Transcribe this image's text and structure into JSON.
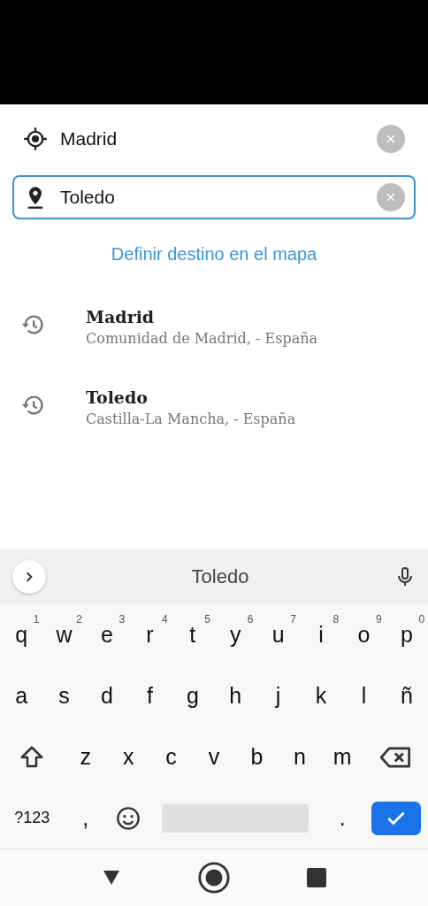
{
  "fields": [
    {
      "kind": "origin",
      "value": "Madrid",
      "focused": false
    },
    {
      "kind": "destination",
      "value": "Toledo",
      "focused": true
    }
  ],
  "map_link": "Definir destino en el mapa",
  "history": [
    {
      "title": "Madrid",
      "subtitle": "Comunidad de Madrid, - España"
    },
    {
      "title": "Toledo",
      "subtitle": "Castilla-La Mancha, - España"
    }
  ],
  "keyboard": {
    "suggestion": "Toledo",
    "rows": [
      [
        {
          "kind": "letter",
          "label": "q",
          "hint": "1"
        },
        {
          "kind": "letter",
          "label": "w",
          "hint": "2"
        },
        {
          "kind": "letter",
          "label": "e",
          "hint": "3"
        },
        {
          "kind": "letter",
          "label": "r",
          "hint": "4"
        },
        {
          "kind": "letter",
          "label": "t",
          "hint": "5"
        },
        {
          "kind": "letter",
          "label": "y",
          "hint": "6"
        },
        {
          "kind": "letter",
          "label": "u",
          "hint": "7"
        },
        {
          "kind": "letter",
          "label": "i",
          "hint": "8"
        },
        {
          "kind": "letter",
          "label": "o",
          "hint": "9"
        },
        {
          "kind": "letter",
          "label": "p",
          "hint": "0"
        }
      ],
      [
        {
          "kind": "letter",
          "label": "a"
        },
        {
          "kind": "letter",
          "label": "s"
        },
        {
          "kind": "letter",
          "label": "d"
        },
        {
          "kind": "letter",
          "label": "f"
        },
        {
          "kind": "letter",
          "label": "g"
        },
        {
          "kind": "letter",
          "label": "h"
        },
        {
          "kind": "letter",
          "label": "j"
        },
        {
          "kind": "letter",
          "label": "k"
        },
        {
          "kind": "letter",
          "label": "l"
        },
        {
          "kind": "letter",
          "label": "ñ"
        }
      ],
      [
        {
          "kind": "shift"
        },
        {
          "kind": "letter",
          "label": "z"
        },
        {
          "kind": "letter",
          "label": "x"
        },
        {
          "kind": "letter",
          "label": "c"
        },
        {
          "kind": "letter",
          "label": "v"
        },
        {
          "kind": "letter",
          "label": "b"
        },
        {
          "kind": "letter",
          "label": "n"
        },
        {
          "kind": "letter",
          "label": "m"
        },
        {
          "kind": "backspace"
        }
      ],
      [
        {
          "kind": "symbols",
          "label": "?123"
        },
        {
          "kind": "letter",
          "label": ","
        },
        {
          "kind": "emoji"
        },
        {
          "kind": "space"
        },
        {
          "kind": "letter",
          "label": "."
        },
        {
          "kind": "enter"
        }
      ]
    ]
  }
}
